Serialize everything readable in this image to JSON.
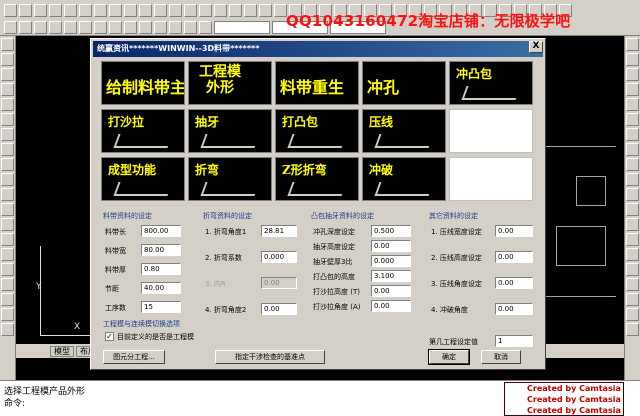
{
  "watermark": "QQ1043160472淘宝店铺：无限极学吧",
  "canvas": {
    "ucs_y": "Y",
    "ucs_x": "X"
  },
  "tabs": [
    "模型",
    "布局"
  ],
  "command": {
    "line1": "选择工程模产品外形",
    "line2": "命令:"
  },
  "camtasia": [
    "Created by Camtasia",
    "Created by Camtasia",
    "Created by Camtasia"
  ],
  "dialog": {
    "title": "统赢资讯*******WINWIN--3D料带*******",
    "close_label": "X",
    "tiles": [
      {
        "label": "给制料带主体",
        "style": "big"
      },
      {
        "label": "工程模\n外形",
        "style": "stack"
      },
      {
        "label": "料带重生",
        "style": "big"
      },
      {
        "label": "冲孔",
        "style": "big"
      },
      {
        "label": "冲凸包",
        "style": "small"
      },
      {
        "label": "打沙拉",
        "style": "small"
      },
      {
        "label": "抽牙",
        "style": "small"
      },
      {
        "label": "打凸包",
        "style": "small"
      },
      {
        "label": "压线",
        "style": "small"
      },
      {
        "label": "",
        "style": "empty"
      },
      {
        "label": "成型功能",
        "style": "small"
      },
      {
        "label": "折弯",
        "style": "small"
      },
      {
        "label": "Z形折弯",
        "style": "small"
      },
      {
        "label": "冲破",
        "style": "small"
      },
      {
        "label": "",
        "style": "empty"
      }
    ],
    "panels": {
      "strip": {
        "title": "料带资料的设定",
        "fields": [
          {
            "label": "料带长",
            "value": "800.00"
          },
          {
            "label": "料带宽",
            "value": "80.00"
          },
          {
            "label": "料带厚",
            "value": "0.80"
          },
          {
            "label": "节距",
            "value": "40.00"
          },
          {
            "label": "工序数",
            "value": "15"
          }
        ]
      },
      "bend": {
        "title": "折弯资料的设定",
        "fields": [
          {
            "label": "1. 折弯角度1",
            "value": "28.81",
            "disabled": false
          },
          {
            "label": "2. 折弯系数",
            "value": "0.000",
            "disabled": false
          },
          {
            "label": "3. 内R",
            "value": "0.00",
            "disabled": true
          },
          {
            "label": "4. 折弯角度2",
            "value": "0.00",
            "disabled": false
          }
        ]
      },
      "emboss": {
        "title": "凸包抽牙资料的设定",
        "fields": [
          {
            "label": "冲孔深度设定",
            "value": "0.500"
          },
          {
            "label": "抽牙高度设定",
            "value": "0.00"
          },
          {
            "label": "抽牙壁厚3比",
            "value": "0.000"
          },
          {
            "label": "打凸包的高度",
            "value": "3.100"
          },
          {
            "label": "打沙拉高度 (T)",
            "value": "0.00"
          },
          {
            "label": "打沙拉角度 (A)",
            "value": "0.00"
          }
        ]
      },
      "other": {
        "title": "其它资料的设定",
        "fields": [
          {
            "label": "1. 压线宽度设定",
            "value": "0.00"
          },
          {
            "label": "2. 压线高度设定",
            "value": "0.00"
          },
          {
            "label": "3. 压线角度设定",
            "value": "0.00"
          },
          {
            "label": "4. 冲破角度",
            "value": "0.00"
          }
        ]
      }
    },
    "switch_title": "工程模与连续模切换选项",
    "checkbox_label": "目前定义的是否是工程模",
    "checkbox_checked": true,
    "station_label": "第几工程设定值",
    "station_value": "1",
    "buttons": {
      "divide": "图元分工程...",
      "datum": "指定干涉检查的基准点",
      "ok": "确定",
      "cancel": "取消"
    }
  }
}
